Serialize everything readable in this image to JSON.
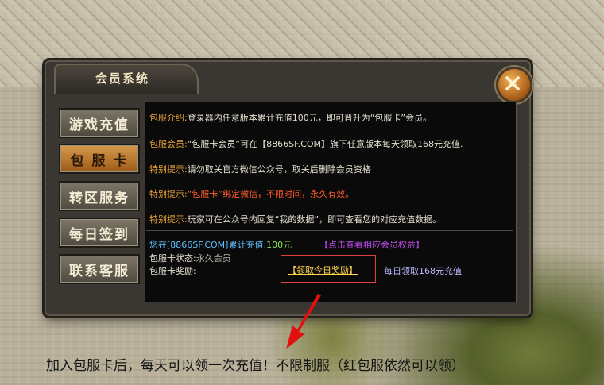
{
  "window": {
    "title": "会员系统"
  },
  "sidebar": {
    "items": [
      {
        "label": "游戏充值",
        "active": false
      },
      {
        "label": "包 服 卡",
        "active": true
      },
      {
        "label": "转区服务",
        "active": false
      },
      {
        "label": "每日签到",
        "active": false
      },
      {
        "label": "联系客服",
        "active": false
      }
    ]
  },
  "info": {
    "intro_key": "包服介绍:",
    "intro_val": "登录器内任意版本累计充值100元，即可晋升为“包服卡”会员。",
    "member_key": "包服会员:",
    "member_val": "“包服卡会员”可在【8866SF.COM】旗下任意版本每天领取168元充值.",
    "tip1_key": "特别提示:",
    "tip1_val": "请勿取关官方微信公众号，取关后删除会员资格",
    "tip2_key": "特别提示:",
    "tip2_val": "“包服卡”绑定微信，不限时间，永久有效。",
    "tip3_key": "特别提示:",
    "tip3_val": "玩家可在公众号内回复“我的数据”，即可查看您的对应充值数据。"
  },
  "status": {
    "recharge_label": "您在[8866SF.COM]累计充值:",
    "recharge_value": "100元",
    "benefits_link": "【点击查看相应会员权益】",
    "card_status_label": "包服卡状态:",
    "card_status_value": "永久会员",
    "reward_label": "包服卡奖励:",
    "claim_button": "【领取今日奖励】",
    "claim_note": "每日领取168元充值"
  },
  "footer": {
    "caption": "加入包服卡后，每天可以领一次充值！不限制服（红包服依然可以领）"
  },
  "colors": {
    "accent": "#e8a339",
    "active_tab": "#c98a3c",
    "highlight_box": "#e04040",
    "link": "#c04cf0"
  }
}
